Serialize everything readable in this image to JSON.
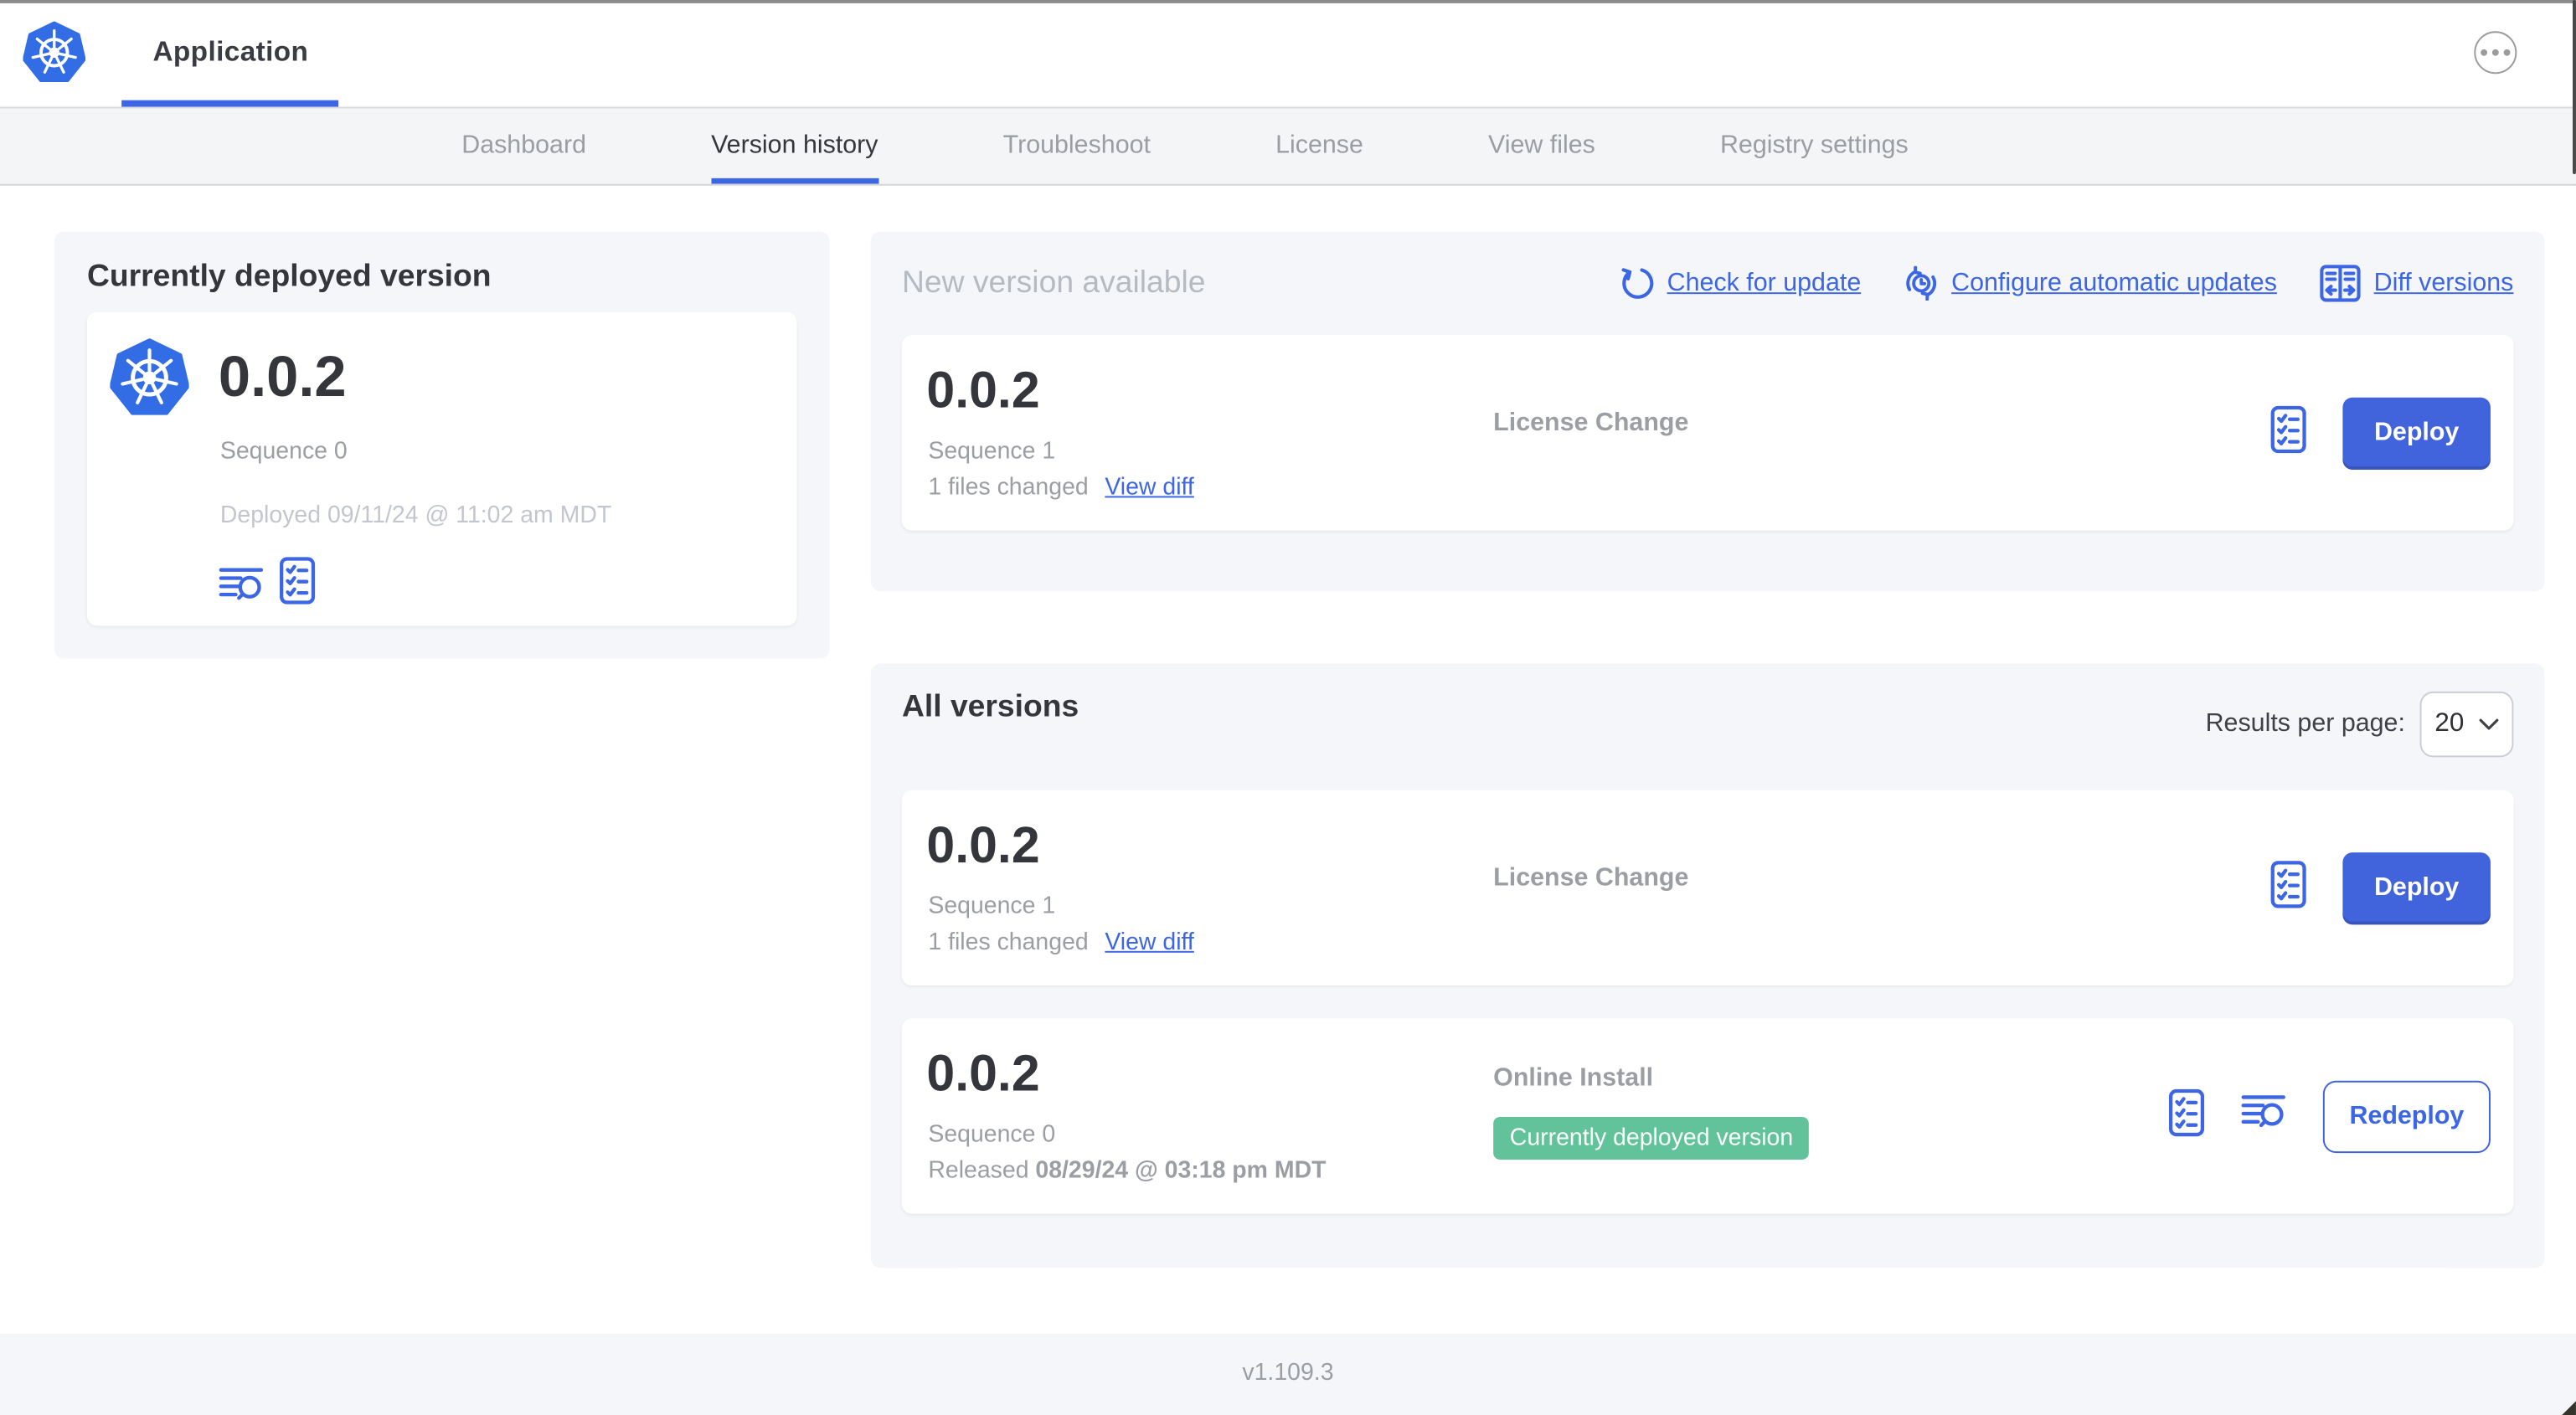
{
  "header": {
    "app_title": "Application"
  },
  "nav": {
    "tabs": [
      {
        "label": "Dashboard",
        "active": false
      },
      {
        "label": "Version history",
        "active": true
      },
      {
        "label": "Troubleshoot",
        "active": false
      },
      {
        "label": "License",
        "active": false
      },
      {
        "label": "View files",
        "active": false
      },
      {
        "label": "Registry settings",
        "active": false
      }
    ]
  },
  "deployed_card": {
    "title": "Currently deployed version",
    "version": "0.0.2",
    "sequence": "Sequence 0",
    "deployed_at": "Deployed 09/11/24 @ 11:02 am MDT",
    "icons": [
      "logs-icon",
      "checklist-icon"
    ]
  },
  "new_version_card": {
    "title": "New version available",
    "actions": [
      {
        "label": "Check for update",
        "icon": "refresh-icon"
      },
      {
        "label": "Configure automatic updates",
        "icon": "clock-refresh-icon"
      },
      {
        "label": "Diff versions",
        "icon": "diff-icon"
      }
    ],
    "row": {
      "version": "0.0.2",
      "sequence": "Sequence 1",
      "files_changed": "1 files changed",
      "view_diff_label": "View diff",
      "source": "License Change",
      "deploy_label": "Deploy",
      "icons": [
        "checklist-icon"
      ]
    }
  },
  "all_versions_card": {
    "title": "All versions",
    "results_per_page_label": "Results per page:",
    "results_per_page_value": "20",
    "rows": [
      {
        "version": "0.0.2",
        "sequence": "Sequence 1",
        "files_changed": "1 files changed",
        "view_diff_label": "View diff",
        "source": "License Change",
        "action_label": "Deploy",
        "icons": [
          "checklist-icon"
        ]
      },
      {
        "version": "0.0.2",
        "sequence": "Sequence 0",
        "released_prefix": "Released",
        "released_date": "08/29/24 @ 03:18 pm MDT",
        "source": "Online Install",
        "badge": "Currently deployed version",
        "action_label": "Redeploy",
        "icons": [
          "checklist-icon",
          "logs-icon"
        ]
      }
    ]
  },
  "footer": {
    "app_version": "v1.109.3"
  },
  "colors": {
    "accent_blue": "#3c66e4",
    "button_blue": "#4164dc",
    "logo_blue": "#326de6",
    "badge_green": "#62c39b",
    "text_dark": "#36383d",
    "text_gray": "#9b9ea3",
    "text_light_gray": "#c3c7cd",
    "muted_title": "#b6bac1",
    "card_bg": "#f4f6f9",
    "nav_bg": "#f4f5f7"
  }
}
